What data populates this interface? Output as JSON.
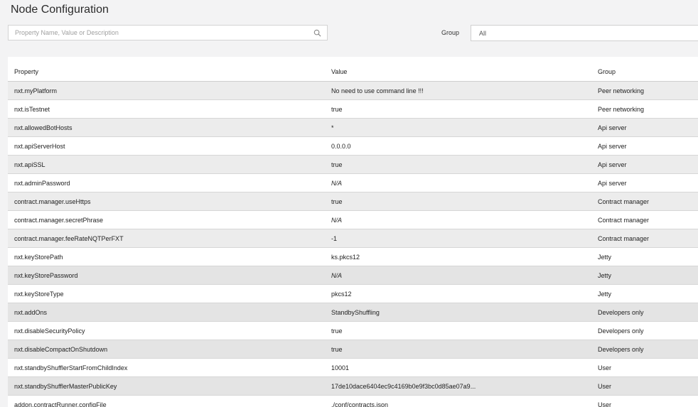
{
  "header": {
    "title": "Node Configuration",
    "search_placeholder": "Property Name, Value or Description",
    "search_value": "",
    "group_label": "Group",
    "group_selected": "All"
  },
  "table": {
    "columns": [
      "Property",
      "Value",
      "Group"
    ],
    "rows": [
      {
        "property": "nxt.myPlatform",
        "value": "No need to use command line !!!",
        "group": "Peer networking",
        "italic": false,
        "bg": "#ececec"
      },
      {
        "property": "nxt.isTestnet",
        "value": "true",
        "group": "Peer networking",
        "italic": false,
        "bg": "#ffffff"
      },
      {
        "property": "nxt.allowedBotHosts",
        "value": "*",
        "group": "Api server",
        "italic": false,
        "bg": "#ececec"
      },
      {
        "property": "nxt.apiServerHost",
        "value": "0.0.0.0",
        "group": "Api server",
        "italic": false,
        "bg": "#ffffff"
      },
      {
        "property": "nxt.apiSSL",
        "value": "true",
        "group": "Api server",
        "italic": false,
        "bg": "#ececec"
      },
      {
        "property": "nxt.adminPassword",
        "value": "N/A",
        "group": "Api server",
        "italic": true,
        "bg": "#ffffff"
      },
      {
        "property": "contract.manager.useHttps",
        "value": "true",
        "group": "Contract manager",
        "italic": false,
        "bg": "#ececec"
      },
      {
        "property": "contract.manager.secretPhrase",
        "value": "N/A",
        "group": "Contract manager",
        "italic": true,
        "bg": "#ffffff"
      },
      {
        "property": "contract.manager.feeRateNQTPerFXT",
        "value": "-1",
        "group": "Contract manager",
        "italic": false,
        "bg": "#ececec"
      },
      {
        "property": "nxt.keyStorePath",
        "value": "ks.pkcs12",
        "group": "Jetty",
        "italic": false,
        "bg": "#ffffff"
      },
      {
        "property": "nxt.keyStorePassword",
        "value": "N/A",
        "group": "Jetty",
        "italic": true,
        "bg": "#e4e4e4"
      },
      {
        "property": "nxt.keyStoreType",
        "value": "pkcs12",
        "group": "Jetty",
        "italic": false,
        "bg": "#ffffff"
      },
      {
        "property": "nxt.addOns",
        "value": "StandbyShuffling",
        "group": "Developers only",
        "italic": false,
        "bg": "#e4e4e4"
      },
      {
        "property": "nxt.disableSecurityPolicy",
        "value": "true",
        "group": "Developers only",
        "italic": false,
        "bg": "#ffffff"
      },
      {
        "property": "nxt.disableCompactOnShutdown",
        "value": "true",
        "group": "Developers only",
        "italic": false,
        "bg": "#e4e4e4"
      },
      {
        "property": "nxt.standbyShufflerStartFromChildIndex",
        "value": "10001",
        "group": "User",
        "italic": false,
        "bg": "#ffffff"
      },
      {
        "property": "nxt.standbyShufflerMasterPublicKey",
        "value": "17de10dace6404ec9c4169b0e9f3bc0d85ae07a9...",
        "group": "User",
        "italic": false,
        "bg": "#e4e4e4"
      },
      {
        "property": "addon.contractRunner.configFile",
        "value": "./conf/contracts.json",
        "group": "User",
        "italic": false,
        "bg": "#ffffff"
      }
    ]
  }
}
